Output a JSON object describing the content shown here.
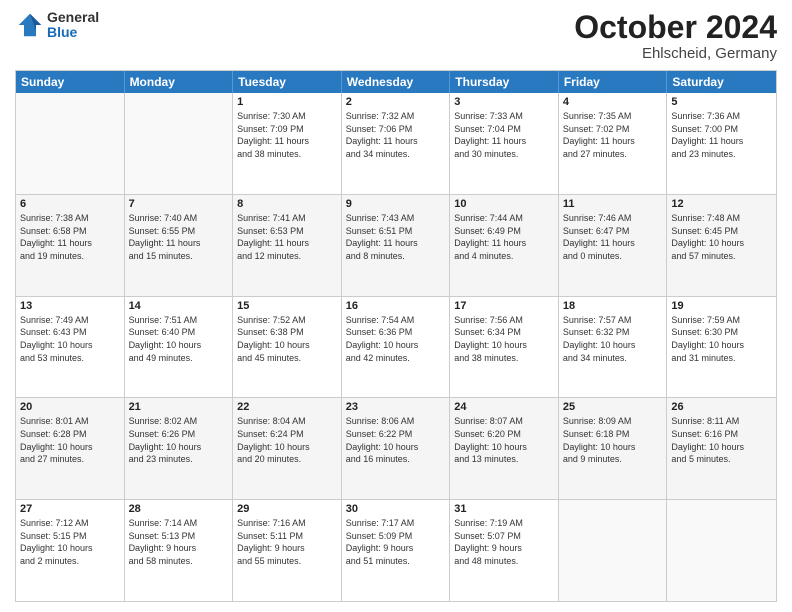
{
  "header": {
    "logo": {
      "general": "General",
      "blue": "Blue"
    },
    "title": "October 2024",
    "location": "Ehlscheid, Germany"
  },
  "weekdays": [
    "Sunday",
    "Monday",
    "Tuesday",
    "Wednesday",
    "Thursday",
    "Friday",
    "Saturday"
  ],
  "rows": [
    [
      {
        "day": "",
        "info": ""
      },
      {
        "day": "",
        "info": ""
      },
      {
        "day": "1",
        "info": "Sunrise: 7:30 AM\nSunset: 7:09 PM\nDaylight: 11 hours\nand 38 minutes."
      },
      {
        "day": "2",
        "info": "Sunrise: 7:32 AM\nSunset: 7:06 PM\nDaylight: 11 hours\nand 34 minutes."
      },
      {
        "day": "3",
        "info": "Sunrise: 7:33 AM\nSunset: 7:04 PM\nDaylight: 11 hours\nand 30 minutes."
      },
      {
        "day": "4",
        "info": "Sunrise: 7:35 AM\nSunset: 7:02 PM\nDaylight: 11 hours\nand 27 minutes."
      },
      {
        "day": "5",
        "info": "Sunrise: 7:36 AM\nSunset: 7:00 PM\nDaylight: 11 hours\nand 23 minutes."
      }
    ],
    [
      {
        "day": "6",
        "info": "Sunrise: 7:38 AM\nSunset: 6:58 PM\nDaylight: 11 hours\nand 19 minutes."
      },
      {
        "day": "7",
        "info": "Sunrise: 7:40 AM\nSunset: 6:55 PM\nDaylight: 11 hours\nand 15 minutes."
      },
      {
        "day": "8",
        "info": "Sunrise: 7:41 AM\nSunset: 6:53 PM\nDaylight: 11 hours\nand 12 minutes."
      },
      {
        "day": "9",
        "info": "Sunrise: 7:43 AM\nSunset: 6:51 PM\nDaylight: 11 hours\nand 8 minutes."
      },
      {
        "day": "10",
        "info": "Sunrise: 7:44 AM\nSunset: 6:49 PM\nDaylight: 11 hours\nand 4 minutes."
      },
      {
        "day": "11",
        "info": "Sunrise: 7:46 AM\nSunset: 6:47 PM\nDaylight: 11 hours\nand 0 minutes."
      },
      {
        "day": "12",
        "info": "Sunrise: 7:48 AM\nSunset: 6:45 PM\nDaylight: 10 hours\nand 57 minutes."
      }
    ],
    [
      {
        "day": "13",
        "info": "Sunrise: 7:49 AM\nSunset: 6:43 PM\nDaylight: 10 hours\nand 53 minutes."
      },
      {
        "day": "14",
        "info": "Sunrise: 7:51 AM\nSunset: 6:40 PM\nDaylight: 10 hours\nand 49 minutes."
      },
      {
        "day": "15",
        "info": "Sunrise: 7:52 AM\nSunset: 6:38 PM\nDaylight: 10 hours\nand 45 minutes."
      },
      {
        "day": "16",
        "info": "Sunrise: 7:54 AM\nSunset: 6:36 PM\nDaylight: 10 hours\nand 42 minutes."
      },
      {
        "day": "17",
        "info": "Sunrise: 7:56 AM\nSunset: 6:34 PM\nDaylight: 10 hours\nand 38 minutes."
      },
      {
        "day": "18",
        "info": "Sunrise: 7:57 AM\nSunset: 6:32 PM\nDaylight: 10 hours\nand 34 minutes."
      },
      {
        "day": "19",
        "info": "Sunrise: 7:59 AM\nSunset: 6:30 PM\nDaylight: 10 hours\nand 31 minutes."
      }
    ],
    [
      {
        "day": "20",
        "info": "Sunrise: 8:01 AM\nSunset: 6:28 PM\nDaylight: 10 hours\nand 27 minutes."
      },
      {
        "day": "21",
        "info": "Sunrise: 8:02 AM\nSunset: 6:26 PM\nDaylight: 10 hours\nand 23 minutes."
      },
      {
        "day": "22",
        "info": "Sunrise: 8:04 AM\nSunset: 6:24 PM\nDaylight: 10 hours\nand 20 minutes."
      },
      {
        "day": "23",
        "info": "Sunrise: 8:06 AM\nSunset: 6:22 PM\nDaylight: 10 hours\nand 16 minutes."
      },
      {
        "day": "24",
        "info": "Sunrise: 8:07 AM\nSunset: 6:20 PM\nDaylight: 10 hours\nand 13 minutes."
      },
      {
        "day": "25",
        "info": "Sunrise: 8:09 AM\nSunset: 6:18 PM\nDaylight: 10 hours\nand 9 minutes."
      },
      {
        "day": "26",
        "info": "Sunrise: 8:11 AM\nSunset: 6:16 PM\nDaylight: 10 hours\nand 5 minutes."
      }
    ],
    [
      {
        "day": "27",
        "info": "Sunrise: 7:12 AM\nSunset: 5:15 PM\nDaylight: 10 hours\nand 2 minutes."
      },
      {
        "day": "28",
        "info": "Sunrise: 7:14 AM\nSunset: 5:13 PM\nDaylight: 9 hours\nand 58 minutes."
      },
      {
        "day": "29",
        "info": "Sunrise: 7:16 AM\nSunset: 5:11 PM\nDaylight: 9 hours\nand 55 minutes."
      },
      {
        "day": "30",
        "info": "Sunrise: 7:17 AM\nSunset: 5:09 PM\nDaylight: 9 hours\nand 51 minutes."
      },
      {
        "day": "31",
        "info": "Sunrise: 7:19 AM\nSunset: 5:07 PM\nDaylight: 9 hours\nand 48 minutes."
      },
      {
        "day": "",
        "info": ""
      },
      {
        "day": "",
        "info": ""
      }
    ]
  ]
}
